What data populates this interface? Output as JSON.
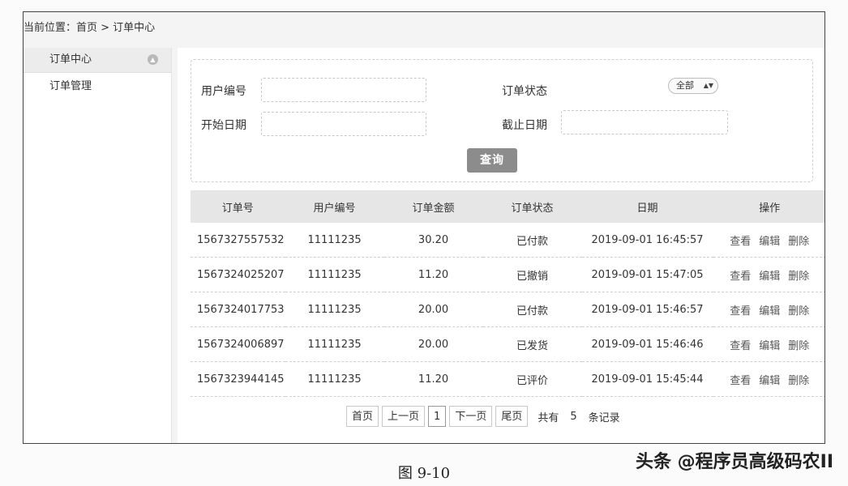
{
  "breadcrumb": "当前位置：首页 > 订单中心",
  "sidebar": {
    "header": "订单中心",
    "items": [
      "订单管理"
    ]
  },
  "search": {
    "user_id_label": "用户编号",
    "status_label": "订单状态",
    "status_value": "全部",
    "start_date_label": "开始日期",
    "end_date_label": "截止日期",
    "query_button": "查询"
  },
  "table": {
    "headers": [
      "订单号",
      "用户编号",
      "订单金额",
      "订单状态",
      "日期",
      "操作"
    ],
    "actions": [
      "查看",
      "编辑",
      "删除"
    ],
    "rows": [
      [
        "1567327557532",
        "11111235",
        "30.20",
        "已付款",
        "2019-09-01 16:45:57"
      ],
      [
        "1567324025207",
        "11111235",
        "11.20",
        "已撤销",
        "2019-09-01 15:47:05"
      ],
      [
        "1567324017753",
        "11111235",
        "20.00",
        "已付款",
        "2019-09-01 15:46:57"
      ],
      [
        "1567324006897",
        "11111235",
        "20.00",
        "已发货",
        "2019-09-01 15:46:46"
      ],
      [
        "1567323944145",
        "11111235",
        "11.20",
        "已评价",
        "2019-09-01 15:45:44"
      ]
    ]
  },
  "pager": {
    "first": "首页",
    "prev": "上一页",
    "current": "1",
    "next": "下一页",
    "last": "尾页",
    "total_prefix": "共有",
    "total": "5",
    "total_suffix": "条记录"
  },
  "caption": "图 9-10",
  "watermark": "头条 @程序员高级码农II"
}
